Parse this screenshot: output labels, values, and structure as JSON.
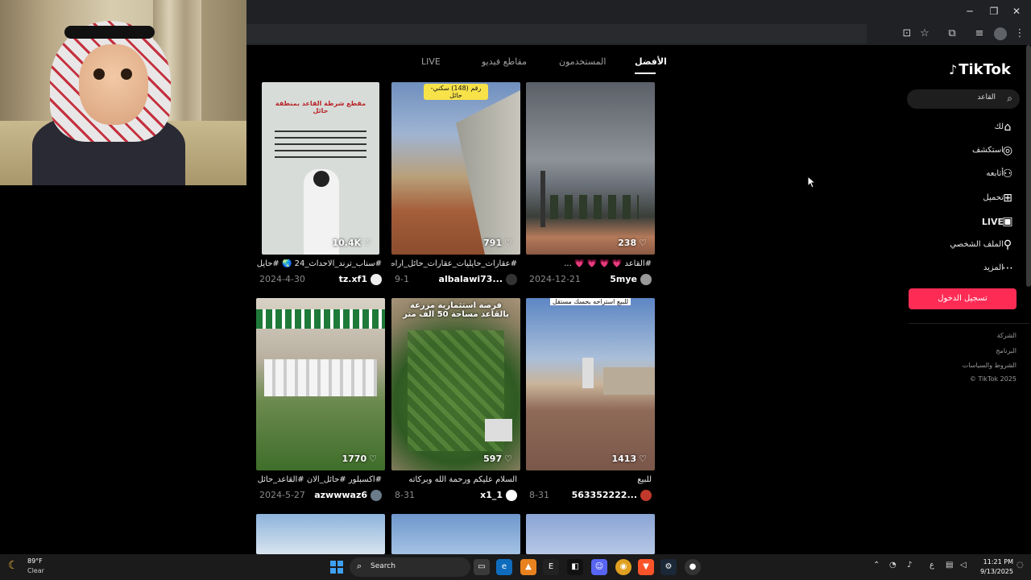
{
  "tabs": [
    {
      "label": "الأفضل",
      "active": true
    },
    {
      "label": "المستخدمون"
    },
    {
      "label": "مقاطع فيديو"
    },
    {
      "label": "LIVE"
    }
  ],
  "search": {
    "query": "القاعد"
  },
  "logo": "TikTok",
  "nav": [
    {
      "label": "لك",
      "icon": "home-icon"
    },
    {
      "label": "استكشف",
      "icon": "compass-icon"
    },
    {
      "label": "أتابعه",
      "icon": "following-icon"
    },
    {
      "label": "تحميل",
      "icon": "upload-icon"
    },
    {
      "label": "LIVE",
      "icon": "live-icon"
    },
    {
      "label": "الملف الشخصي",
      "icon": "profile-icon"
    },
    {
      "label": "المزيد",
      "icon": "more-icon"
    }
  ],
  "login_button": "تسجيل الدخول",
  "footer": [
    "الشركة",
    "البرنامج",
    "الشروط والسياسات",
    "© TikTok 2025"
  ],
  "videos": [
    {
      "likes": "238",
      "caption": "#القاعد 💗 💗 💗 💗 ...",
      "date": "2024-12-21",
      "author": "5mye"
    },
    {
      "likes": "791",
      "caption": "#عقارات_حايليات_عقارات_حائل_اراضي_...",
      "date": "9-1",
      "author": "albalawi73...",
      "overlay": "رقم (148) سكني- حائل"
    },
    {
      "likes": "10.4K",
      "caption": "#سناب_ترند_الاحداث_24 🌏 #حايل",
      "date": "2024-4-30",
      "author": "tz.xf1",
      "overlay": "مقطع شرطة القاعد بمنطقة حائل"
    },
    {
      "likes": "1413",
      "caption": "للبيع",
      "date": "8-31",
      "author": "563352222...",
      "overlay": "للبيع استراحه بحسك مستقل"
    },
    {
      "likes": "597",
      "caption": "السلام عليكم ورحمة الله وبركاته",
      "date": "8-31",
      "author": "x1_1",
      "overlay": "فرصة استثمارية مزرعة بالقاعد مساحة 50 الف متر"
    },
    {
      "likes": "1770",
      "caption": "#اكسبلور #حائل_الان #القاعد_حائل ...",
      "date": "2024-5-27",
      "author": "azwwwaz6"
    }
  ],
  "taskbar": {
    "weather_temp": "89°F",
    "weather_desc": "Clear",
    "search_label": "Search",
    "time": "11:21 PM",
    "date": "9/13/2025",
    "lang": "ع"
  }
}
